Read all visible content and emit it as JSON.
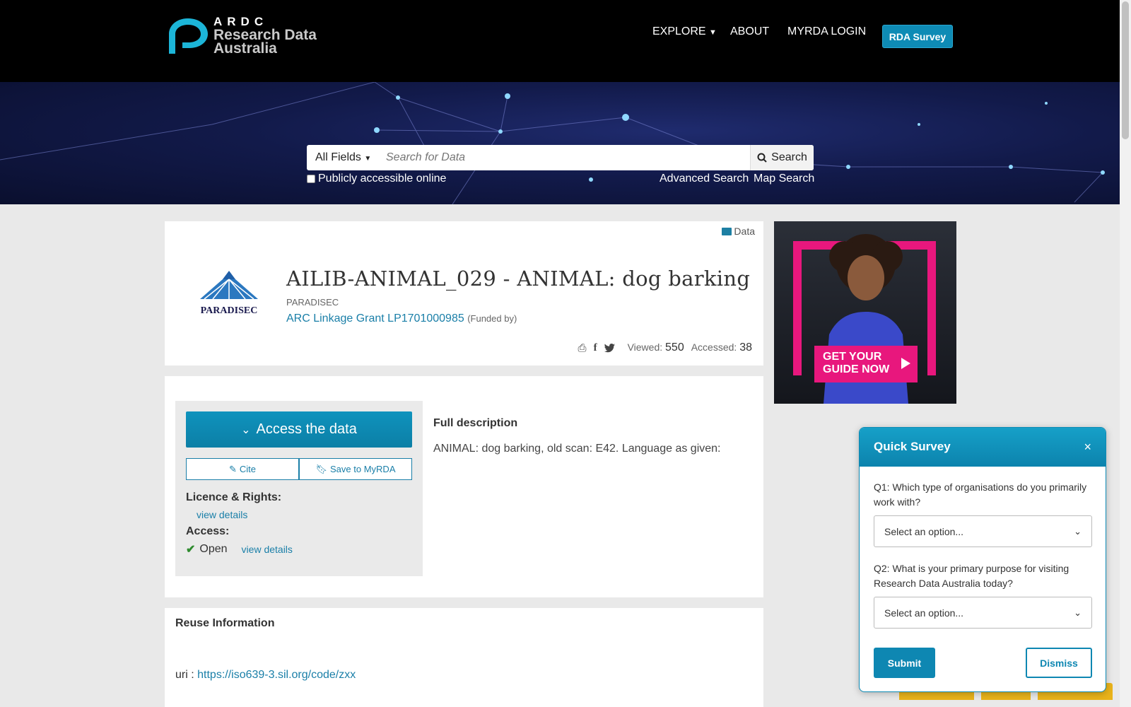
{
  "header": {
    "logo_abbr": "ARDC",
    "logo_line1": "Research Data",
    "logo_line2": "Australia",
    "nav": {
      "explore": "EXPLORE",
      "about": "ABOUT",
      "login": "MYRDA LOGIN"
    },
    "survey_button": "RDA Survey"
  },
  "search": {
    "field_select": "All Fields",
    "placeholder": "Search for Data",
    "button": "Search",
    "public_checkbox_label": "Publicly accessible online",
    "public_checked": false,
    "advanced_link": "Advanced Search",
    "map_link": "Map Search"
  },
  "record": {
    "type_tag": "Data",
    "org_logo_name": "PARADISEC",
    "title": "AILIB-ANIMAL_029 - ANIMAL: dog barking",
    "publisher": "PARADISEC",
    "grant_link": "ARC Linkage Grant LP1701000985",
    "grant_note": "(Funded by)",
    "viewed_label": "Viewed:",
    "viewed_count": "550",
    "accessed_label": "Accessed:",
    "accessed_count": "38"
  },
  "access_panel": {
    "access_button": "Access the data",
    "cite_button": "Cite",
    "save_button": "Save to MyRDA",
    "licence_label": "Licence & Rights:",
    "licence_link": "view details",
    "access_label": "Access:",
    "access_status": "Open",
    "access_link": "view details"
  },
  "description": {
    "title": "Full description",
    "text": "ANIMAL: dog barking, old scan: E42. Language as given:"
  },
  "reuse": {
    "title": "Reuse Information",
    "uri_label": "uri :",
    "uri_link": "https://iso639-3.sil.org/code/zxx"
  },
  "ad": {
    "cta_line1": "GET YOUR",
    "cta_line2": "GUIDE NOW"
  },
  "quick_survey": {
    "title": "Quick Survey",
    "close": "×",
    "q1": "Q1: Which type of organisations do you primarily work with?",
    "q1_value": "Select an option...",
    "q2": "Q2: What is your primary purpose for visiting Research Data Australia today?",
    "q2_value": "Select an option...",
    "submit": "Submit",
    "dismiss": "Dismiss"
  },
  "colors": {
    "accent": "#0e8bb5",
    "link": "#1a7fa8",
    "ad_pink": "#e8177d",
    "open_green": "#2e8b2e"
  }
}
